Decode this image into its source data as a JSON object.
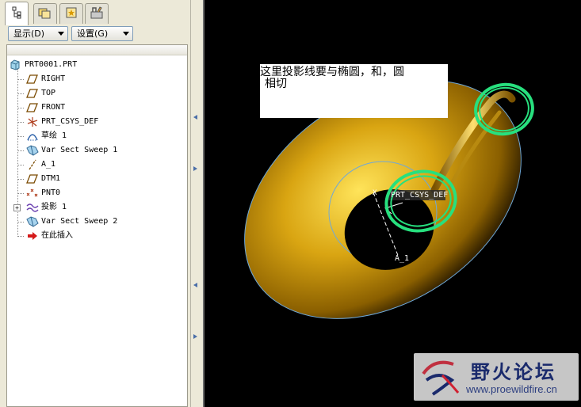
{
  "tabs": [
    {
      "name": "model-tree-tab",
      "icon": "model-tree-icon"
    },
    {
      "name": "folder-browser-tab",
      "icon": "folder-icon"
    },
    {
      "name": "favorites-tab",
      "icon": "favorites-icon"
    },
    {
      "name": "connections-tab",
      "icon": "tools-icon"
    }
  ],
  "toolbar": {
    "show_label": "显示(D)",
    "settings_label": "设置(G)"
  },
  "tree": {
    "root": "PRT0001.PRT",
    "items": [
      {
        "label": "RIGHT",
        "icon": "datum-plane-icon"
      },
      {
        "label": "TOP",
        "icon": "datum-plane-icon"
      },
      {
        "label": "FRONT",
        "icon": "datum-plane-icon"
      },
      {
        "label": "PRT_CSYS_DEF",
        "icon": "csys-icon"
      },
      {
        "label": "草绘 1",
        "icon": "sketch-icon"
      },
      {
        "label": "Var Sect Sweep 1",
        "icon": "sweep-icon"
      },
      {
        "label": "A_1",
        "icon": "datum-axis-icon"
      },
      {
        "label": "DTM1",
        "icon": "datum-plane-icon"
      },
      {
        "label": "PNT0",
        "icon": "datum-point-icon"
      },
      {
        "label": "投影 1",
        "icon": "projection-icon"
      },
      {
        "label": "Var Sect Sweep 2",
        "icon": "sweep-icon"
      },
      {
        "label": "在此插入",
        "icon": "insert-here-icon"
      }
    ]
  },
  "viewport": {
    "annotation_line1": "这里投影线要与椭圆，和，圆",
    "annotation_line2": "相切",
    "csys_label": "PRT_CSYS_DEF",
    "axis_label": "A_1",
    "point_label": "X",
    "colors": {
      "body": "#c8960a",
      "highlight": "#ffe45a",
      "edge": "#6fa8d8",
      "marker": "#27e07e"
    }
  },
  "watermark": {
    "title": "野火论坛",
    "url": "www.proewildfire.cn"
  }
}
